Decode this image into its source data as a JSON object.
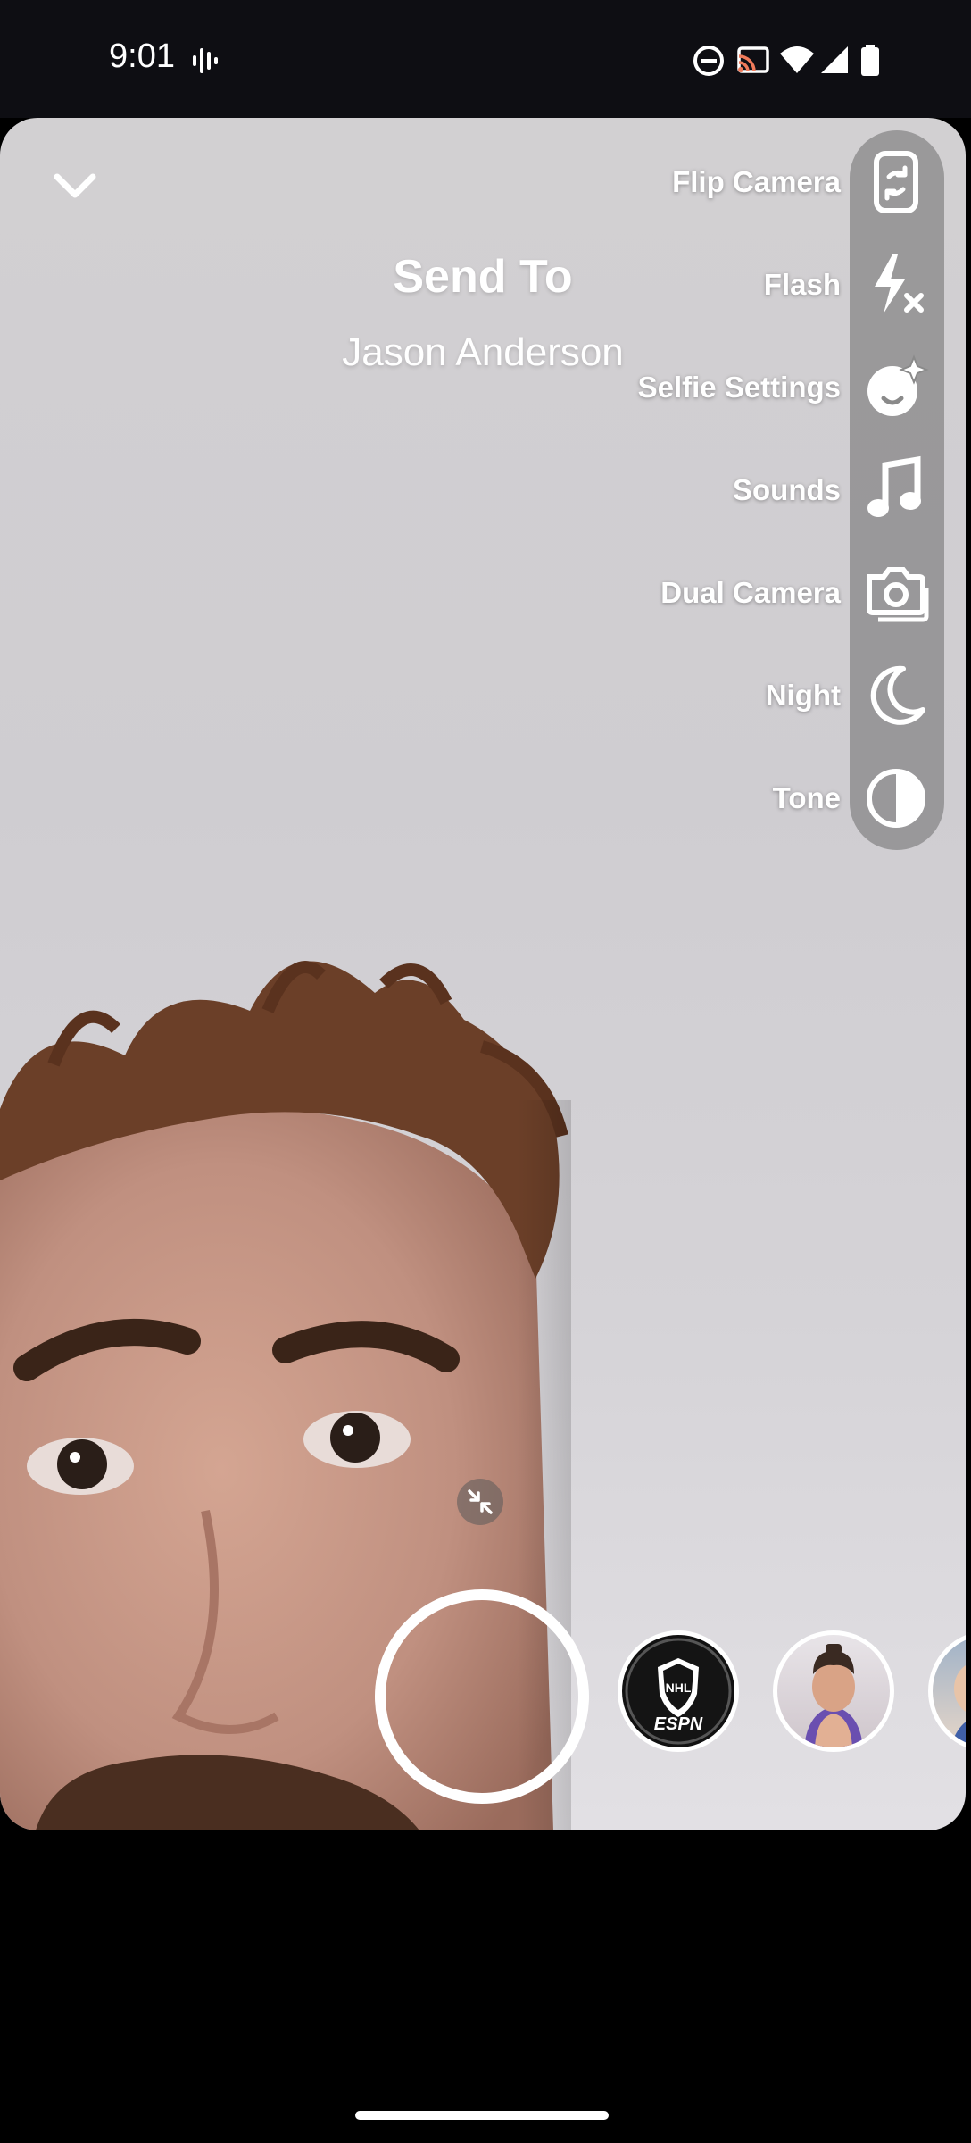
{
  "status_bar": {
    "time": "9:01",
    "icons": [
      "sound-wave-icon",
      "do-not-disturb-icon",
      "cast-icon",
      "wifi-icon",
      "signal-icon",
      "battery-icon"
    ]
  },
  "camera": {
    "collapse_icon": "chevron-down-icon",
    "send_to_title": "Send To",
    "recipient_name": "Jason Anderson"
  },
  "tools": [
    {
      "label": "Flip Camera",
      "icon": "flip-camera-icon"
    },
    {
      "label": "Flash",
      "icon": "flash-off-icon"
    },
    {
      "label": "Selfie Settings",
      "icon": "selfie-settings-icon"
    },
    {
      "label": "Sounds",
      "icon": "music-note-icon"
    },
    {
      "label": "Dual Camera",
      "icon": "dual-camera-icon"
    },
    {
      "label": "Night",
      "icon": "moon-icon"
    },
    {
      "label": "Tone",
      "icon": "tone-icon"
    }
  ],
  "lenses": {
    "shutter_icon": "shutter-button",
    "items": [
      {
        "name": "NHL ESPN lens",
        "badge_text": "ESPN",
        "logo_text": "NHL"
      },
      {
        "name": "character lens"
      },
      {
        "name": "partial lens"
      }
    ]
  },
  "colors": {
    "status_bar_bg": "#0e0e13",
    "rail_bg": "#787878",
    "text": "#ffffff"
  }
}
